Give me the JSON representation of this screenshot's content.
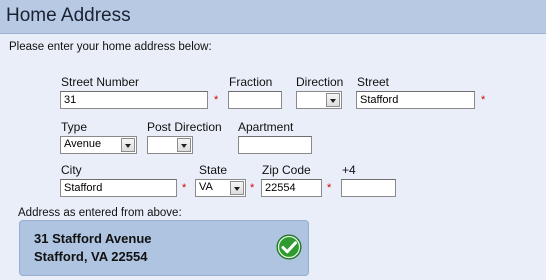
{
  "header": {
    "title": "Home Address"
  },
  "instructions": "Please enter your home address below:",
  "labels": {
    "street_number": "Street Number",
    "fraction": "Fraction",
    "direction": "Direction",
    "street": "Street",
    "type": "Type",
    "post_direction": "Post Direction",
    "apartment": "Apartment",
    "city": "City",
    "state": "State",
    "zip": "Zip Code",
    "plus4": "+4"
  },
  "fields": {
    "street_number": "31",
    "fraction": "",
    "direction": "",
    "street": "Stafford",
    "type": "Avenue",
    "post_direction": "",
    "apartment": "",
    "city": "Stafford",
    "state": "VA",
    "zip": "22554",
    "plus4": ""
  },
  "required_mark": "*",
  "result": {
    "caption": "Address as entered from above:",
    "line1": "31 Stafford Avenue",
    "line2": "Stafford, VA 22554"
  },
  "icons": {
    "valid": "check-circle-icon",
    "dropdown": "chevron-down-icon"
  },
  "colors": {
    "header_bg": "#b8cae3",
    "page_bg": "#e9eef8",
    "result_bg": "#afc4e0",
    "required": "#d40000",
    "check_green": "#2f9a2f"
  }
}
